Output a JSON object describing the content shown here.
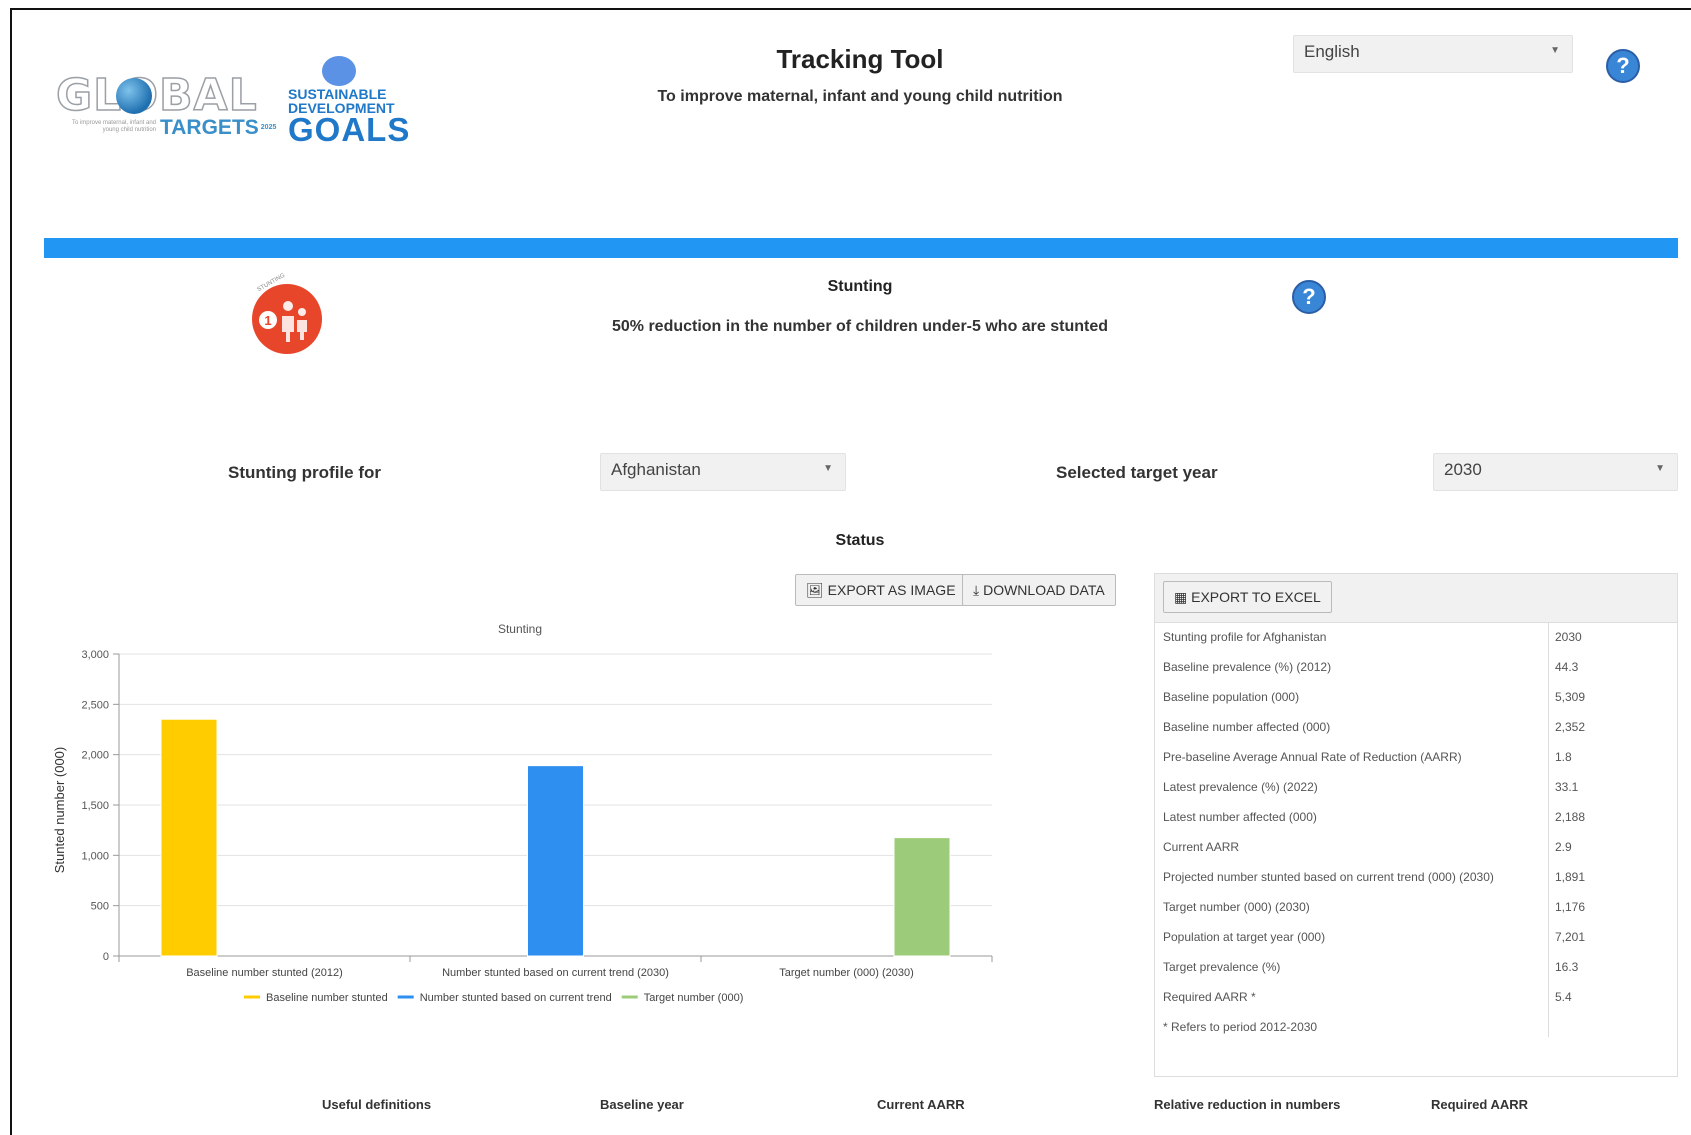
{
  "header": {
    "title": "Tracking Tool",
    "subtitle": "To improve maternal, infant and young child nutrition",
    "language": "English",
    "help_icon": "question-circle-icon"
  },
  "logos": {
    "global_targets": {
      "global_text": "GLOBAL",
      "targets_text": "TARGETS",
      "year": "2025",
      "note": "To improve maternal, infant and young child nutrition"
    },
    "sdg": {
      "line1": "SUSTAINABLE",
      "line2": "DEVELOPMENT",
      "line3": "GOALS"
    }
  },
  "indicator": {
    "icon_label": "STUNTING",
    "icon_number": "1",
    "title": "Stunting",
    "description": "50% reduction in the number of children under-5 who are stunted"
  },
  "filters": {
    "profile_label": "Stunting profile for",
    "country": "Afghanistan",
    "target_year_label": "Selected target year",
    "target_year": "2030"
  },
  "status_label": "Status",
  "buttons": {
    "export_image": "EXPORT AS IMAGE",
    "download_data": "DOWNLOAD DATA",
    "export_excel": "EXPORT TO EXCEL"
  },
  "chart_data": {
    "type": "bar",
    "title": "Stunting",
    "xlabel": "",
    "ylabel": "Stunted number (000)",
    "ylim": [
      0,
      3000
    ],
    "yticks": [
      "0",
      "500",
      "1,000",
      "1,500",
      "2,000",
      "2,500",
      "3,000"
    ],
    "grid": true,
    "legend_position": "bottom",
    "categories": [
      "Baseline number stunted (2012)",
      "Number stunted based on current trend (2030)",
      "Target  number (000) (2030)"
    ],
    "series": [
      {
        "name": "Baseline number stunted",
        "color": "#ffcc00",
        "values": [
          2352,
          null,
          null
        ]
      },
      {
        "name": "Number stunted based on current trend",
        "color": "#2f8ff0",
        "values": [
          null,
          1891,
          null
        ]
      },
      {
        "name": "Target  number (000)",
        "color": "#9ccc7a",
        "values": [
          null,
          null,
          1176
        ]
      }
    ]
  },
  "table": {
    "rows": [
      {
        "label": "Stunting profile for Afghanistan",
        "value": "2030"
      },
      {
        "label": "Baseline prevalence (%) (2012)",
        "value": "44.3"
      },
      {
        "label": "Baseline population (000)",
        "value": "5,309"
      },
      {
        "label": "Baseline number affected (000)",
        "value": "2,352"
      },
      {
        "label": "Pre-baseline Average Annual Rate of Reduction (AARR)",
        "value": "1.8"
      },
      {
        "label": "Latest prevalence (%) (2022)",
        "value": "33.1"
      },
      {
        "label": "Latest number affected (000)",
        "value": "2,188"
      },
      {
        "label": "Current AARR",
        "value": "2.9"
      },
      {
        "label": "Projected number stunted based on current trend (000) (2030)",
        "value": "1,891"
      },
      {
        "label": "Target number (000) (2030)",
        "value": "1,176"
      },
      {
        "label": "Population at target year (000)",
        "value": "7,201"
      },
      {
        "label": "Target prevalence (%)",
        "value": "16.3"
      },
      {
        "label": "Required AARR *",
        "value": "5.4"
      },
      {
        "label": "* Refers to period 2012-2030",
        "value": ""
      }
    ]
  },
  "footer": {
    "useful_definitions": "Useful definitions",
    "baseline_year": "Baseline year",
    "current_aarr": "Current AARR",
    "relative_reduction": "Relative reduction in numbers",
    "required_aarr": "Required AARR"
  }
}
